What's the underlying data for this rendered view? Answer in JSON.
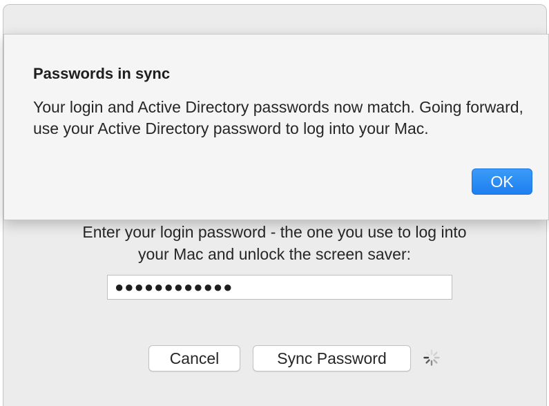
{
  "alert": {
    "title": "Passwords in sync",
    "message": "Your login and Active Directory passwords now match. Going forward, use your Active Directory password to log into your Mac.",
    "ok_label": "OK",
    "ok_color": "#1f7ff0"
  },
  "dialog": {
    "prompt_line1": "Enter your login password - the one you use to log into",
    "prompt_line2": "your Mac and unlock the screen saver:",
    "password_value": "●●●●●●●●●●●●",
    "cancel_label": "Cancel",
    "sync_label": "Sync Password",
    "spinner_icon": "progress-spinner-icon"
  }
}
